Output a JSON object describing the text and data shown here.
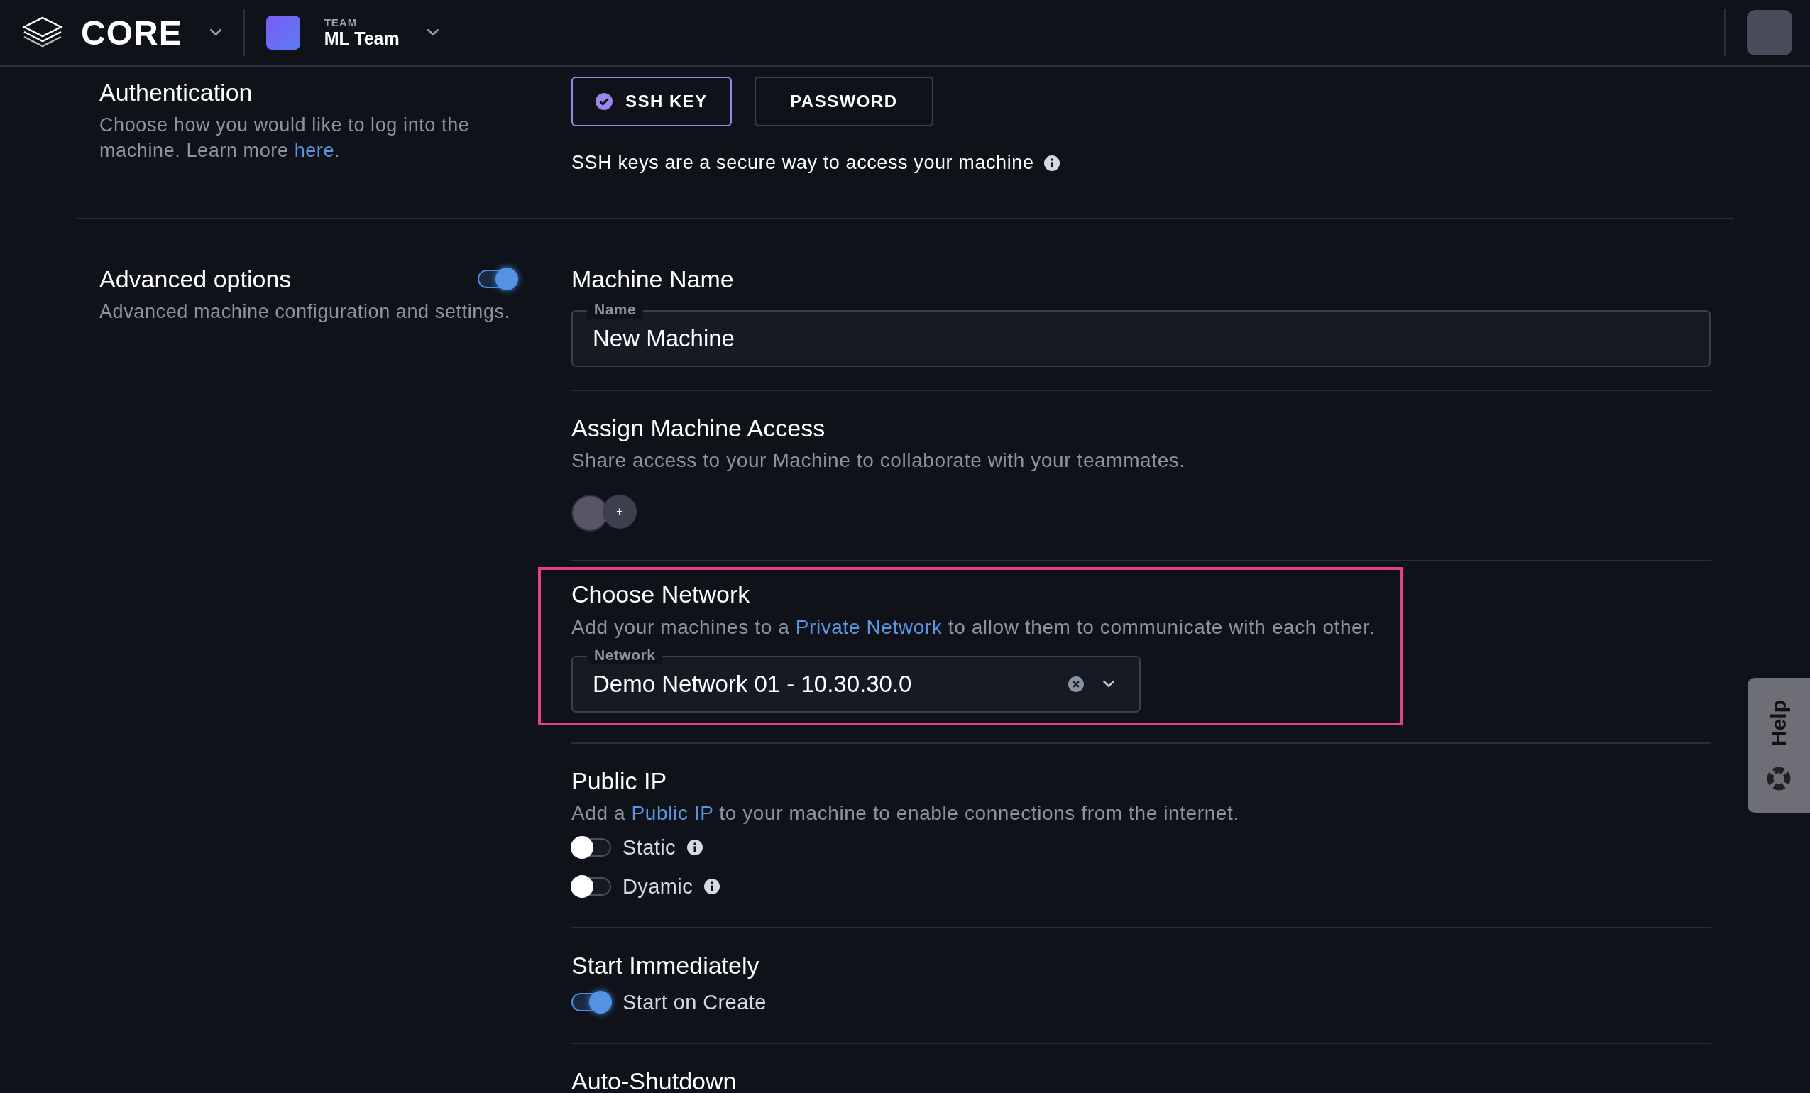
{
  "header": {
    "logo_text": "CORE",
    "team_label": "TEAM",
    "team_name": "ML Team"
  },
  "authentication": {
    "title": "Authentication",
    "description": "Choose how you would like to log into the machine. Learn more ",
    "link": "here",
    "suffix": ".",
    "options": [
      {
        "label": "SSH KEY",
        "selected": true
      },
      {
        "label": "PASSWORD",
        "selected": false
      }
    ],
    "hint": "SSH keys are a secure way to access your machine"
  },
  "advanced": {
    "title": "Advanced options",
    "description": "Advanced machine configuration and settings.",
    "on": true
  },
  "sections": [
    {
      "kind": "text_field",
      "title": "Machine Name",
      "field_label": "Name",
      "value": "New Machine"
    },
    {
      "kind": "access",
      "title": "Assign Machine Access",
      "description": "Share access to your Machine to collaborate with your teammates.",
      "add_label": "+"
    },
    {
      "kind": "select",
      "highlighted": true,
      "title": "Choose Network",
      "description_before": "Add your machines to a ",
      "link": "Private Network",
      "description_after": " to allow them to communicate with each other.",
      "field_label": "Network",
      "value": "Demo Network 01 - 10.30.30.0"
    },
    {
      "kind": "toggles",
      "title": "Public IP",
      "description_before": "Add a ",
      "link": "Public IP",
      "description_after": " to your machine to enable connections from the internet.",
      "toggles": [
        {
          "label": "Static",
          "on": false,
          "info": true
        },
        {
          "label": "Dyamic",
          "on": false,
          "info": true
        }
      ]
    },
    {
      "kind": "toggles",
      "title": "Start Immediately",
      "toggles": [
        {
          "label": "Start on Create",
          "on": true,
          "info": false
        }
      ]
    },
    {
      "kind": "heading",
      "title": "Auto-Shutdown"
    }
  ],
  "help_tab": {
    "label": "Help"
  }
}
